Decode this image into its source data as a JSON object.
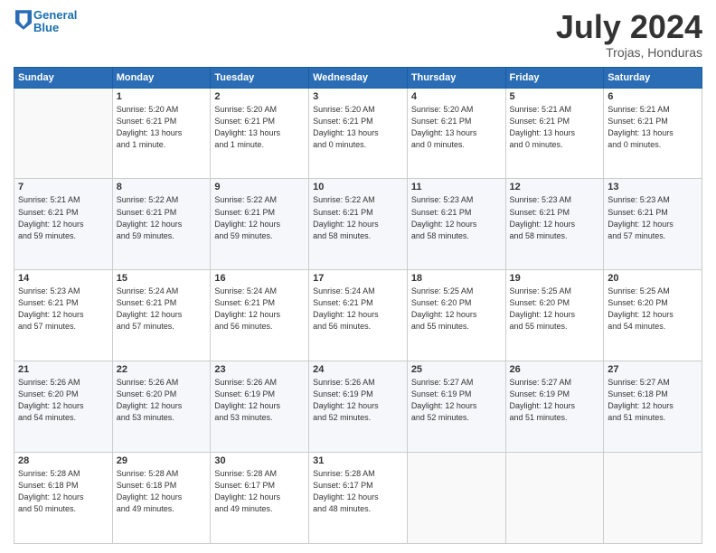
{
  "header": {
    "logo_line1": "General",
    "logo_line2": "Blue",
    "month_year": "July 2024",
    "location": "Trojas, Honduras"
  },
  "weekdays": [
    "Sunday",
    "Monday",
    "Tuesday",
    "Wednesday",
    "Thursday",
    "Friday",
    "Saturday"
  ],
  "weeks": [
    [
      {
        "day": "",
        "info": ""
      },
      {
        "day": "1",
        "info": "Sunrise: 5:20 AM\nSunset: 6:21 PM\nDaylight: 13 hours\nand 1 minute."
      },
      {
        "day": "2",
        "info": "Sunrise: 5:20 AM\nSunset: 6:21 PM\nDaylight: 13 hours\nand 1 minute."
      },
      {
        "day": "3",
        "info": "Sunrise: 5:20 AM\nSunset: 6:21 PM\nDaylight: 13 hours\nand 0 minutes."
      },
      {
        "day": "4",
        "info": "Sunrise: 5:20 AM\nSunset: 6:21 PM\nDaylight: 13 hours\nand 0 minutes."
      },
      {
        "day": "5",
        "info": "Sunrise: 5:21 AM\nSunset: 6:21 PM\nDaylight: 13 hours\nand 0 minutes."
      },
      {
        "day": "6",
        "info": "Sunrise: 5:21 AM\nSunset: 6:21 PM\nDaylight: 13 hours\nand 0 minutes."
      }
    ],
    [
      {
        "day": "7",
        "info": "Sunrise: 5:21 AM\nSunset: 6:21 PM\nDaylight: 12 hours\nand 59 minutes."
      },
      {
        "day": "8",
        "info": "Sunrise: 5:22 AM\nSunset: 6:21 PM\nDaylight: 12 hours\nand 59 minutes."
      },
      {
        "day": "9",
        "info": "Sunrise: 5:22 AM\nSunset: 6:21 PM\nDaylight: 12 hours\nand 59 minutes."
      },
      {
        "day": "10",
        "info": "Sunrise: 5:22 AM\nSunset: 6:21 PM\nDaylight: 12 hours\nand 58 minutes."
      },
      {
        "day": "11",
        "info": "Sunrise: 5:23 AM\nSunset: 6:21 PM\nDaylight: 12 hours\nand 58 minutes."
      },
      {
        "day": "12",
        "info": "Sunrise: 5:23 AM\nSunset: 6:21 PM\nDaylight: 12 hours\nand 58 minutes."
      },
      {
        "day": "13",
        "info": "Sunrise: 5:23 AM\nSunset: 6:21 PM\nDaylight: 12 hours\nand 57 minutes."
      }
    ],
    [
      {
        "day": "14",
        "info": "Sunrise: 5:23 AM\nSunset: 6:21 PM\nDaylight: 12 hours\nand 57 minutes."
      },
      {
        "day": "15",
        "info": "Sunrise: 5:24 AM\nSunset: 6:21 PM\nDaylight: 12 hours\nand 57 minutes."
      },
      {
        "day": "16",
        "info": "Sunrise: 5:24 AM\nSunset: 6:21 PM\nDaylight: 12 hours\nand 56 minutes."
      },
      {
        "day": "17",
        "info": "Sunrise: 5:24 AM\nSunset: 6:21 PM\nDaylight: 12 hours\nand 56 minutes."
      },
      {
        "day": "18",
        "info": "Sunrise: 5:25 AM\nSunset: 6:20 PM\nDaylight: 12 hours\nand 55 minutes."
      },
      {
        "day": "19",
        "info": "Sunrise: 5:25 AM\nSunset: 6:20 PM\nDaylight: 12 hours\nand 55 minutes."
      },
      {
        "day": "20",
        "info": "Sunrise: 5:25 AM\nSunset: 6:20 PM\nDaylight: 12 hours\nand 54 minutes."
      }
    ],
    [
      {
        "day": "21",
        "info": "Sunrise: 5:26 AM\nSunset: 6:20 PM\nDaylight: 12 hours\nand 54 minutes."
      },
      {
        "day": "22",
        "info": "Sunrise: 5:26 AM\nSunset: 6:20 PM\nDaylight: 12 hours\nand 53 minutes."
      },
      {
        "day": "23",
        "info": "Sunrise: 5:26 AM\nSunset: 6:19 PM\nDaylight: 12 hours\nand 53 minutes."
      },
      {
        "day": "24",
        "info": "Sunrise: 5:26 AM\nSunset: 6:19 PM\nDaylight: 12 hours\nand 52 minutes."
      },
      {
        "day": "25",
        "info": "Sunrise: 5:27 AM\nSunset: 6:19 PM\nDaylight: 12 hours\nand 52 minutes."
      },
      {
        "day": "26",
        "info": "Sunrise: 5:27 AM\nSunset: 6:19 PM\nDaylight: 12 hours\nand 51 minutes."
      },
      {
        "day": "27",
        "info": "Sunrise: 5:27 AM\nSunset: 6:18 PM\nDaylight: 12 hours\nand 51 minutes."
      }
    ],
    [
      {
        "day": "28",
        "info": "Sunrise: 5:28 AM\nSunset: 6:18 PM\nDaylight: 12 hours\nand 50 minutes."
      },
      {
        "day": "29",
        "info": "Sunrise: 5:28 AM\nSunset: 6:18 PM\nDaylight: 12 hours\nand 49 minutes."
      },
      {
        "day": "30",
        "info": "Sunrise: 5:28 AM\nSunset: 6:17 PM\nDaylight: 12 hours\nand 49 minutes."
      },
      {
        "day": "31",
        "info": "Sunrise: 5:28 AM\nSunset: 6:17 PM\nDaylight: 12 hours\nand 48 minutes."
      },
      {
        "day": "",
        "info": ""
      },
      {
        "day": "",
        "info": ""
      },
      {
        "day": "",
        "info": ""
      }
    ]
  ]
}
